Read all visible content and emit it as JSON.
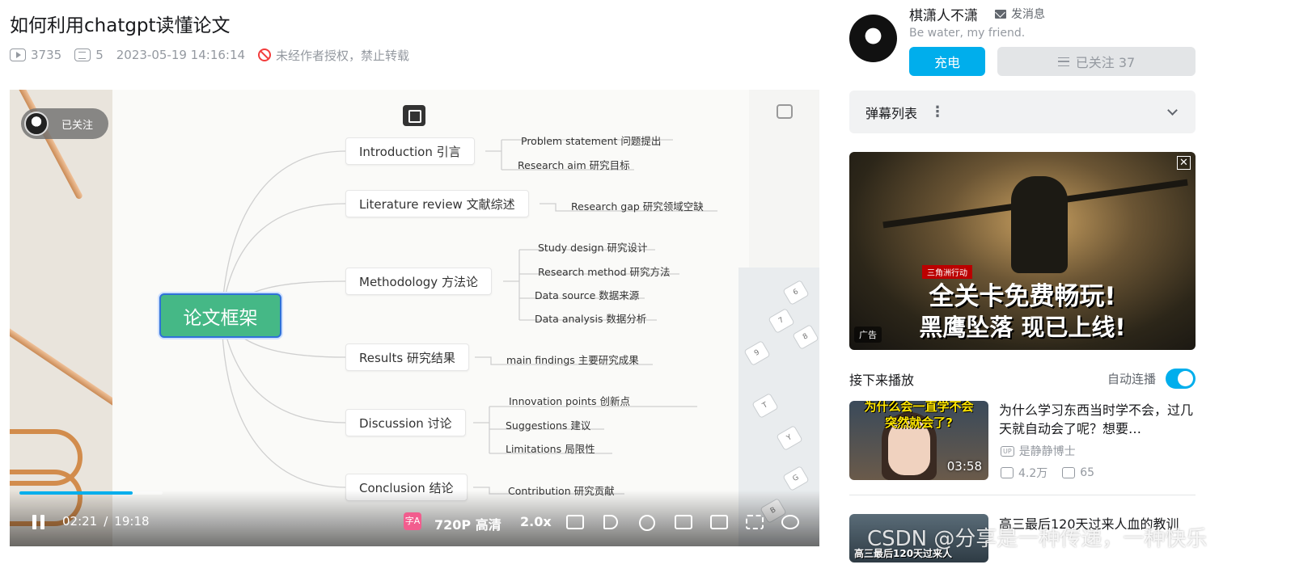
{
  "video": {
    "title": "如何利用chatgpt读懂论文",
    "views": "3735",
    "danmaku_count": "5",
    "date": "2023-05-19 14:16:14",
    "copyright": "未经作者授权，禁止转载"
  },
  "player": {
    "follow_badge": "已关注",
    "current_time": "02:21",
    "separator": "/",
    "total_time": "19:18",
    "progress": 0.12,
    "subtitle_icon": "字A",
    "quality": "720P 高清",
    "speed": "2.0x"
  },
  "mindmap": {
    "root": "论文框架",
    "branches": [
      {
        "label": "Introduction 引言",
        "leaves": [
          "Problem statement 问题提出",
          "Research aim 研究目标"
        ]
      },
      {
        "label": "Literature review 文献综述",
        "leaves": [
          "Research gap 研究领域空缺"
        ]
      },
      {
        "label": "Methodology 方法论",
        "leaves": [
          "Study design 研究设计",
          "Research method 研究方法",
          "Data source 数据来源",
          "Data analysis 数据分析"
        ]
      },
      {
        "label": "Results 研究结果",
        "leaves": [
          "main findings 主要研究成果"
        ]
      },
      {
        "label": "Discussion 讨论",
        "leaves": [
          "Innovation points 创新点",
          "Suggestions 建议",
          "Limitations 局限性"
        ]
      },
      {
        "label": "Conclusion 结论",
        "leaves": [
          "Contribution 研究贡献"
        ]
      }
    ],
    "keys": [
      "6",
      "7",
      "8",
      "9",
      "T",
      "Y",
      "G",
      "B"
    ]
  },
  "uploader": {
    "name": "棋潇人不潇",
    "message": "发消息",
    "signature": "Be water, my friend.",
    "charge": "充电",
    "followed": "已关注 37"
  },
  "danmaku_list": {
    "label": "弹幕列表",
    "more": "⋮"
  },
  "ad": {
    "game_tag": "三角洲行动",
    "line1": "全关卡免费畅玩!",
    "line2": "黑鹰坠落 现已上线!",
    "badge": "广告",
    "close": "✕"
  },
  "up_next": {
    "title": "接下来播放",
    "autoplay": "自动连播",
    "autoplay_on": true
  },
  "recommendations": [
    {
      "title": "为什么学习东西当时学不会，过几天就自动会了呢？想要…",
      "thumb_caption_1": "为什么会一直学不会",
      "thumb_caption_2": "突然就会了?",
      "duration": "03:58",
      "up_tag": "UP",
      "author": "是静静博士",
      "views": "4.2万",
      "danmaku": "65"
    },
    {
      "title": "高三最后120天过来人血的教训",
      "thumb_caption": "高三最后120天过来人"
    }
  ],
  "watermark": "CSDN @分享是一种传递，一种快乐"
}
